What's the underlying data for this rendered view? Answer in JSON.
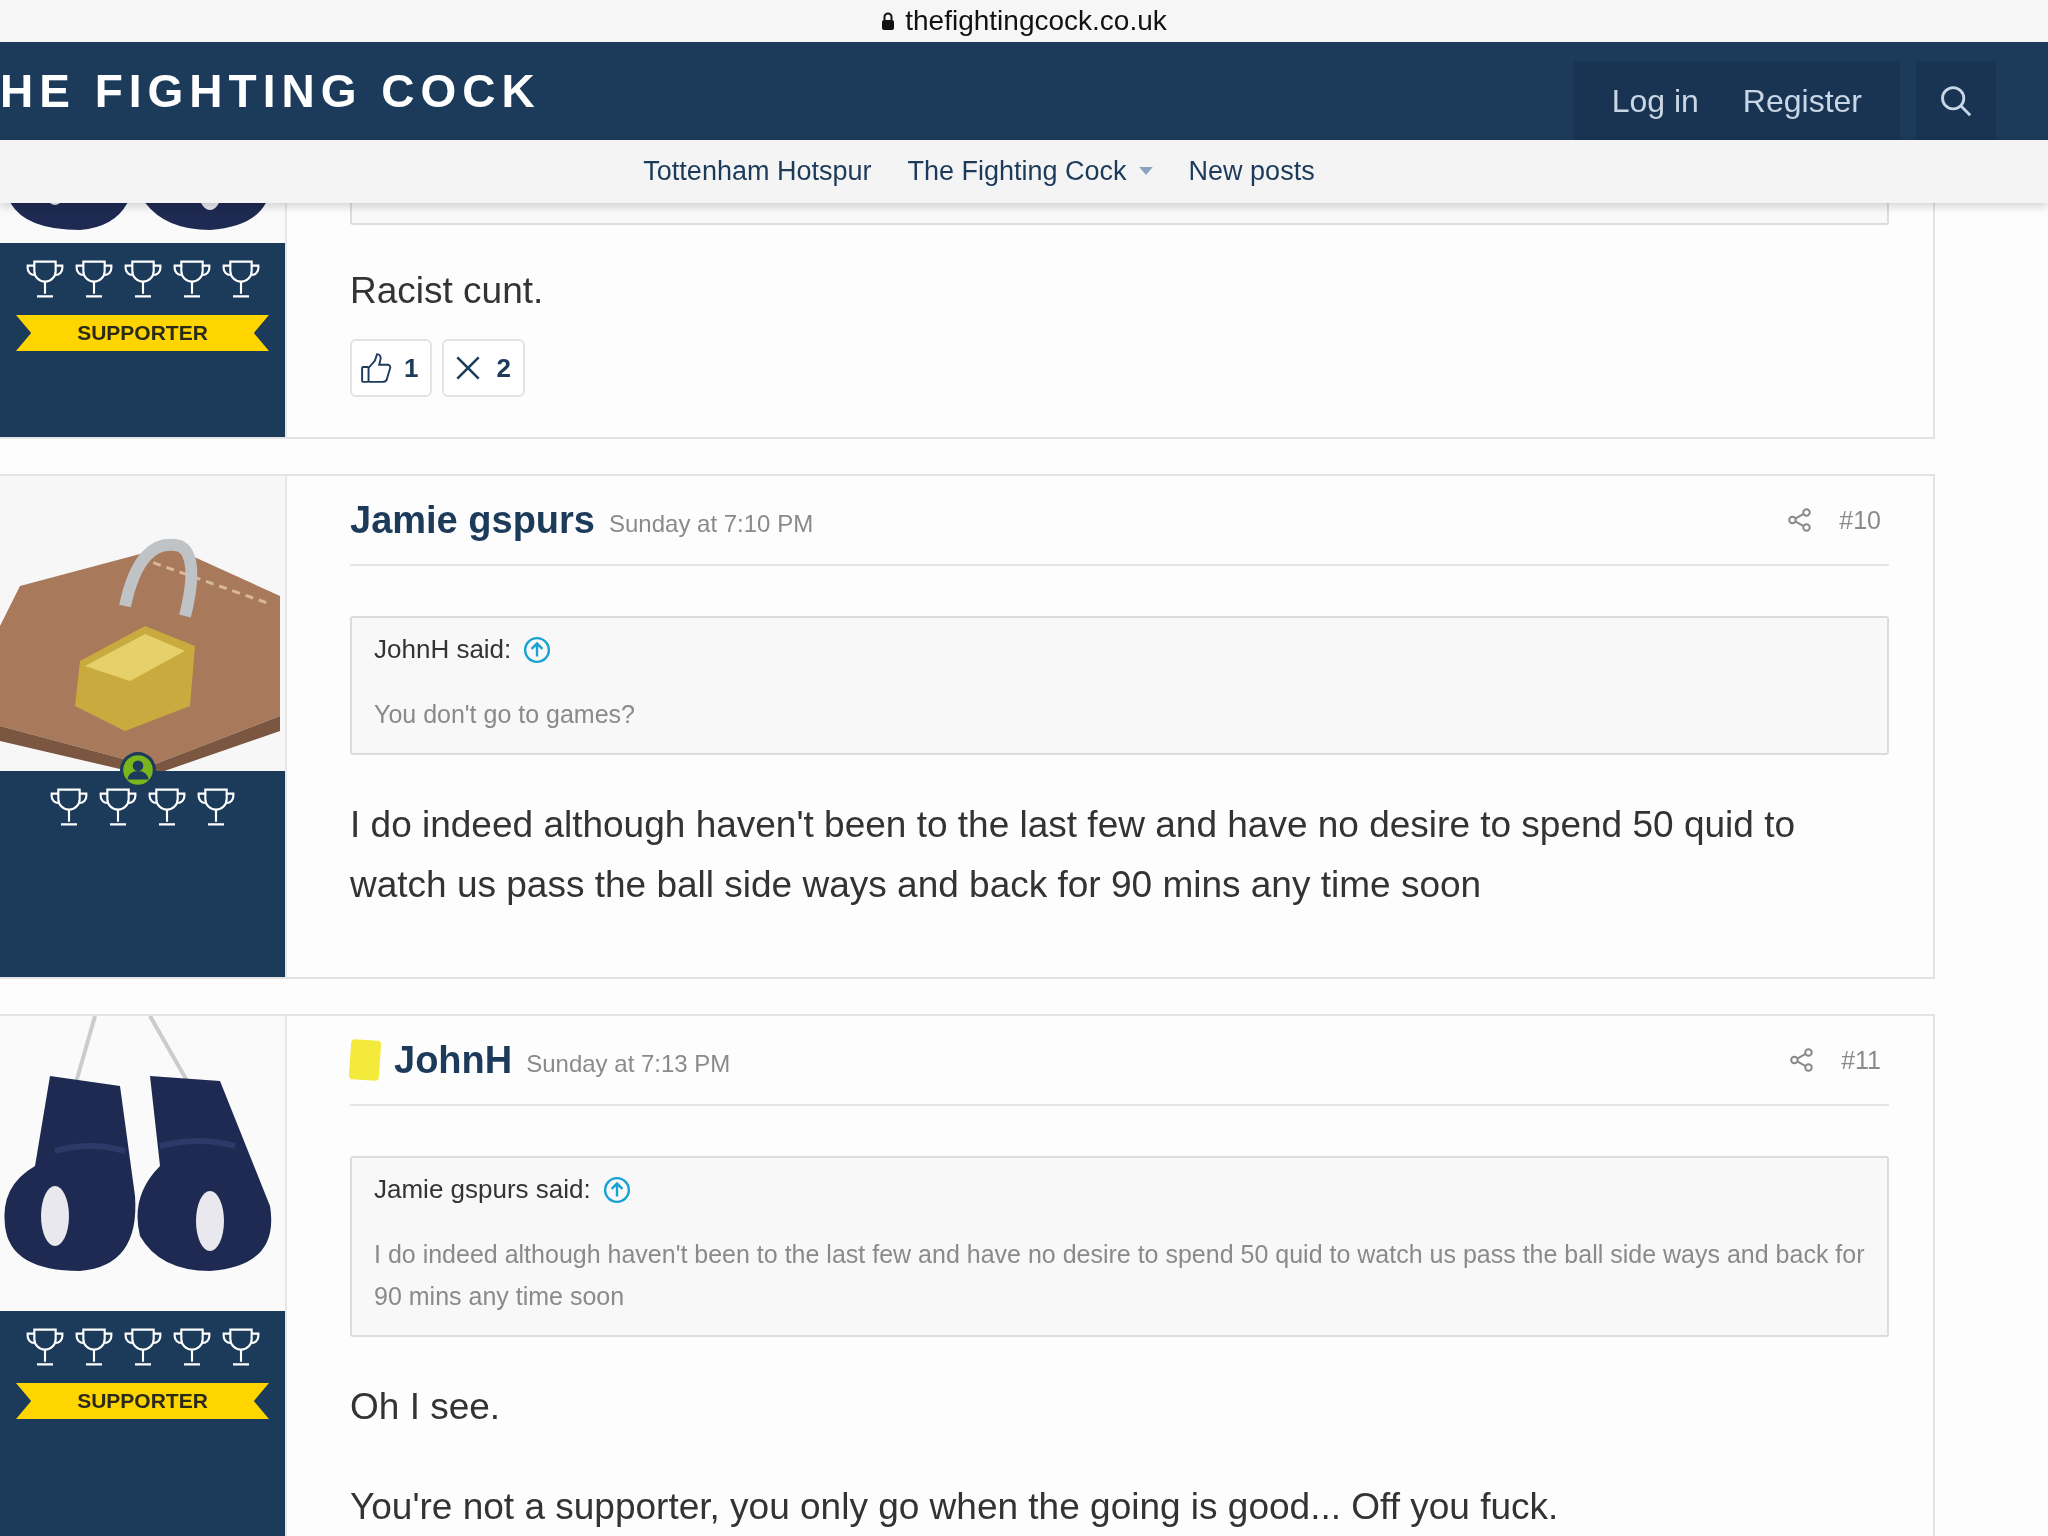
{
  "browser": {
    "address": "thefightingcock.co.uk"
  },
  "header": {
    "title": "HE FIGHTING COCK",
    "actions": [
      "Log in",
      "Register"
    ]
  },
  "nav": [
    {
      "label": "Tottenham Hotspur",
      "dropdown": false
    },
    {
      "label": "The Fighting Cock",
      "dropdown": true
    },
    {
      "label": "New posts",
      "dropdown": false
    }
  ],
  "posts": [
    {
      "cut_off": true,
      "online": false,
      "stars": 5,
      "banner": "SUPPORTER",
      "body": [
        "Racist cunt."
      ],
      "reactions": [
        {
          "kind": "like",
          "count": "1"
        },
        {
          "kind": "cross",
          "count": "2"
        }
      ]
    },
    {
      "cut_off": false,
      "author": "Jamie gspurs",
      "yellow_card": false,
      "date": "Sunday at 7:10 PM",
      "number": "#10",
      "online": true,
      "stars": 4,
      "quote": {
        "author": "JohnH said:",
        "text": "You don't go to games?"
      },
      "body": [
        "I do indeed although haven't been to the last few and have no desire to spend 50 quid to watch us pass the ball side ways and back for 90 mins any time soon"
      ]
    },
    {
      "cut_off": false,
      "author": "JohnH",
      "yellow_card": true,
      "date": "Sunday at 7:13 PM",
      "number": "#11",
      "online": false,
      "stars": 5,
      "banner": "SUPPORTER",
      "quote": {
        "author": "Jamie gspurs said:",
        "text": "I do indeed although haven't been to the last few and have no desire to spend 50 quid to watch us pass the ball side ways and back for 90 mins any time soon"
      },
      "body": [
        "Oh I see.",
        "You're not a supporter, you only go when the going is good... Off you fuck."
      ]
    }
  ]
}
